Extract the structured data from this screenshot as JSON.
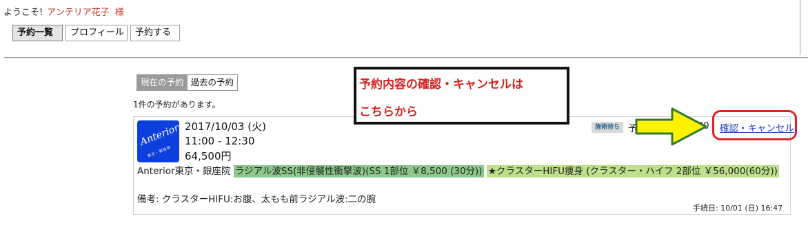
{
  "header": {
    "welcome": "ようこそ!",
    "user_name": "アンテリア花子",
    "honorific": "様"
  },
  "nav": {
    "items": [
      {
        "label": "予約一覧",
        "active": true
      },
      {
        "label": "プロフィール",
        "active": false
      },
      {
        "label": "予約する",
        "active": false
      }
    ]
  },
  "tabs": {
    "current": "現在の予約",
    "past": "過去の予約"
  },
  "reservation_count": "1件の予約があります。",
  "callout": {
    "line1": "予約内容の確認・キャンセルは",
    "line2": "こちらから",
    "color": "#d51f1f"
  },
  "reservation": {
    "logo_text": "Anterior",
    "logo_subtext": "東京・銀座院",
    "date": "2017/10/03 (火)",
    "time": "11:00 - 12:30",
    "price": "64,500円",
    "status": "施術待ち",
    "partial_left": "予",
    "partial_right": "00",
    "cancel_link": "確認・キャンセル",
    "clinic": "Anterior東京・銀座院",
    "menu1": "ラジアル波SS(非侵襲性衝撃波)(SS 1部位 ￥8,500 (30分))",
    "menu2": "★クラスターHIFU痩身 (クラスター・ハイフ 2部位 ￥56,000(60分))",
    "note": "備考: クラスターHIFU:お腹、太もも前ラジアル波:二の腕",
    "procedure_date": "手続日: 10/01 (日) 16:47"
  },
  "colors": {
    "logo_bg": "#0d3fdc",
    "menu1_highlight": "#8ec98b",
    "menu2_highlight": "#bfe08b",
    "arrow_fill": "#fff200",
    "highlight_ring": "#e02222"
  }
}
